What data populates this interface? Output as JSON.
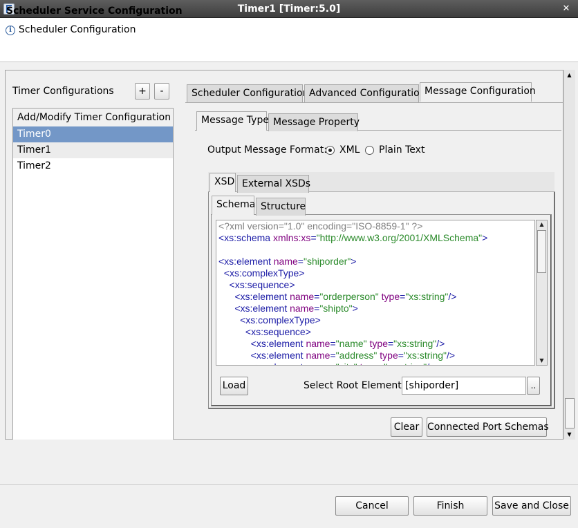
{
  "window": {
    "title": "Timer1 [Timer:5.0]",
    "close_glyph": "✕",
    "app_icon": "app-logo-icon"
  },
  "header": {
    "title": "Scheduler Service Configuration",
    "subtitle": "Scheduler Configuration",
    "info_icon": "i"
  },
  "timer_configs": {
    "label": "Timer Configurations",
    "add_label": "+",
    "remove_label": "-",
    "list_header": "Add/Modify Timer Configuration",
    "items": [
      "Timer0",
      "Timer1",
      "Timer2"
    ],
    "selected_index": 0
  },
  "outer_tabs": {
    "items": [
      "Scheduler Configuration",
      "Advanced Configuration",
      "Message Configuration"
    ],
    "active": "Message Configuration"
  },
  "message_tabs": {
    "items": [
      "Message Type",
      "Message Property"
    ],
    "active": "Message Type"
  },
  "output_format": {
    "label": "Output Message Format:",
    "options": [
      "XML",
      "Plain Text"
    ],
    "selected": "XML"
  },
  "xsd_tabs": {
    "items": [
      "XSD",
      "External XSDs"
    ],
    "active": "XSD"
  },
  "schema_tabs": {
    "items": [
      "Schema",
      "Structure"
    ],
    "active": "Schema"
  },
  "schema_lines": [
    [
      {
        "t": "<?xml version=\"1.0\" encoding=\"ISO-8859-1\" ?>",
        "c": "pi"
      }
    ],
    [
      {
        "t": "<xs:schema ",
        "c": "tag"
      },
      {
        "t": "xmlns:xs",
        "c": "attr"
      },
      {
        "t": "=",
        "c": "tag"
      },
      {
        "t": "\"http://www.w3.org/2001/XMLSchema\"",
        "c": "val"
      },
      {
        "t": ">",
        "c": "tag"
      }
    ],
    [],
    [
      {
        "t": "<xs:element ",
        "c": "tag"
      },
      {
        "t": "name",
        "c": "attr"
      },
      {
        "t": "=",
        "c": "tag"
      },
      {
        "t": "\"shiporder\"",
        "c": "val"
      },
      {
        "t": ">",
        "c": "tag"
      }
    ],
    [
      {
        "t": "  <xs:complexType>",
        "c": "tag"
      }
    ],
    [
      {
        "t": "    <xs:sequence>",
        "c": "tag"
      }
    ],
    [
      {
        "t": "      <xs:element ",
        "c": "tag"
      },
      {
        "t": "name",
        "c": "attr"
      },
      {
        "t": "=",
        "c": "tag"
      },
      {
        "t": "\"orderperson\"",
        "c": "val"
      },
      {
        "t": " ",
        "c": "tag"
      },
      {
        "t": "type",
        "c": "attr"
      },
      {
        "t": "=",
        "c": "tag"
      },
      {
        "t": "\"xs:string\"",
        "c": "val"
      },
      {
        "t": "/>",
        "c": "tag"
      }
    ],
    [
      {
        "t": "      <xs:element ",
        "c": "tag"
      },
      {
        "t": "name",
        "c": "attr"
      },
      {
        "t": "=",
        "c": "tag"
      },
      {
        "t": "\"shipto\"",
        "c": "val"
      },
      {
        "t": ">",
        "c": "tag"
      }
    ],
    [
      {
        "t": "        <xs:complexType>",
        "c": "tag"
      }
    ],
    [
      {
        "t": "          <xs:sequence>",
        "c": "tag"
      }
    ],
    [
      {
        "t": "            <xs:element ",
        "c": "tag"
      },
      {
        "t": "name",
        "c": "attr"
      },
      {
        "t": "=",
        "c": "tag"
      },
      {
        "t": "\"name\"",
        "c": "val"
      },
      {
        "t": " ",
        "c": "tag"
      },
      {
        "t": "type",
        "c": "attr"
      },
      {
        "t": "=",
        "c": "tag"
      },
      {
        "t": "\"xs:string\"",
        "c": "val"
      },
      {
        "t": "/>",
        "c": "tag"
      }
    ],
    [
      {
        "t": "            <xs:element ",
        "c": "tag"
      },
      {
        "t": "name",
        "c": "attr"
      },
      {
        "t": "=",
        "c": "tag"
      },
      {
        "t": "\"address\"",
        "c": "val"
      },
      {
        "t": " ",
        "c": "tag"
      },
      {
        "t": "type",
        "c": "attr"
      },
      {
        "t": "=",
        "c": "tag"
      },
      {
        "t": "\"xs:string\"",
        "c": "val"
      },
      {
        "t": "/>",
        "c": "tag"
      }
    ],
    [
      {
        "t": "            <xs:element ",
        "c": "tag"
      },
      {
        "t": "name",
        "c": "attr"
      },
      {
        "t": "=",
        "c": "tag"
      },
      {
        "t": "\"city\"",
        "c": "val"
      },
      {
        "t": " ",
        "c": "tag"
      },
      {
        "t": "type",
        "c": "attr"
      },
      {
        "t": "=",
        "c": "tag"
      },
      {
        "t": "\"xs:string\"",
        "c": "val"
      },
      {
        "t": "/>",
        "c": "tag"
      }
    ]
  ],
  "schema_controls": {
    "load_label": "Load",
    "root_label": "Select Root Element",
    "root_value": "[shiporder]",
    "browse_label": ".."
  },
  "actions": {
    "clear_label": "Clear",
    "connected_label": "Connected Port Schemas"
  },
  "scroll_arrows": {
    "up": "▲",
    "down": "▼"
  },
  "footer": {
    "cancel_label": "Cancel",
    "finish_label": "Finish",
    "save_close_label": "Save and Close"
  },
  "colors": {
    "selection": "#7397c7",
    "xml_tag": "#1a1aa6",
    "xml_attr": "#7f007f",
    "xml_value": "#2a8a2a",
    "xml_pi": "#808080"
  }
}
